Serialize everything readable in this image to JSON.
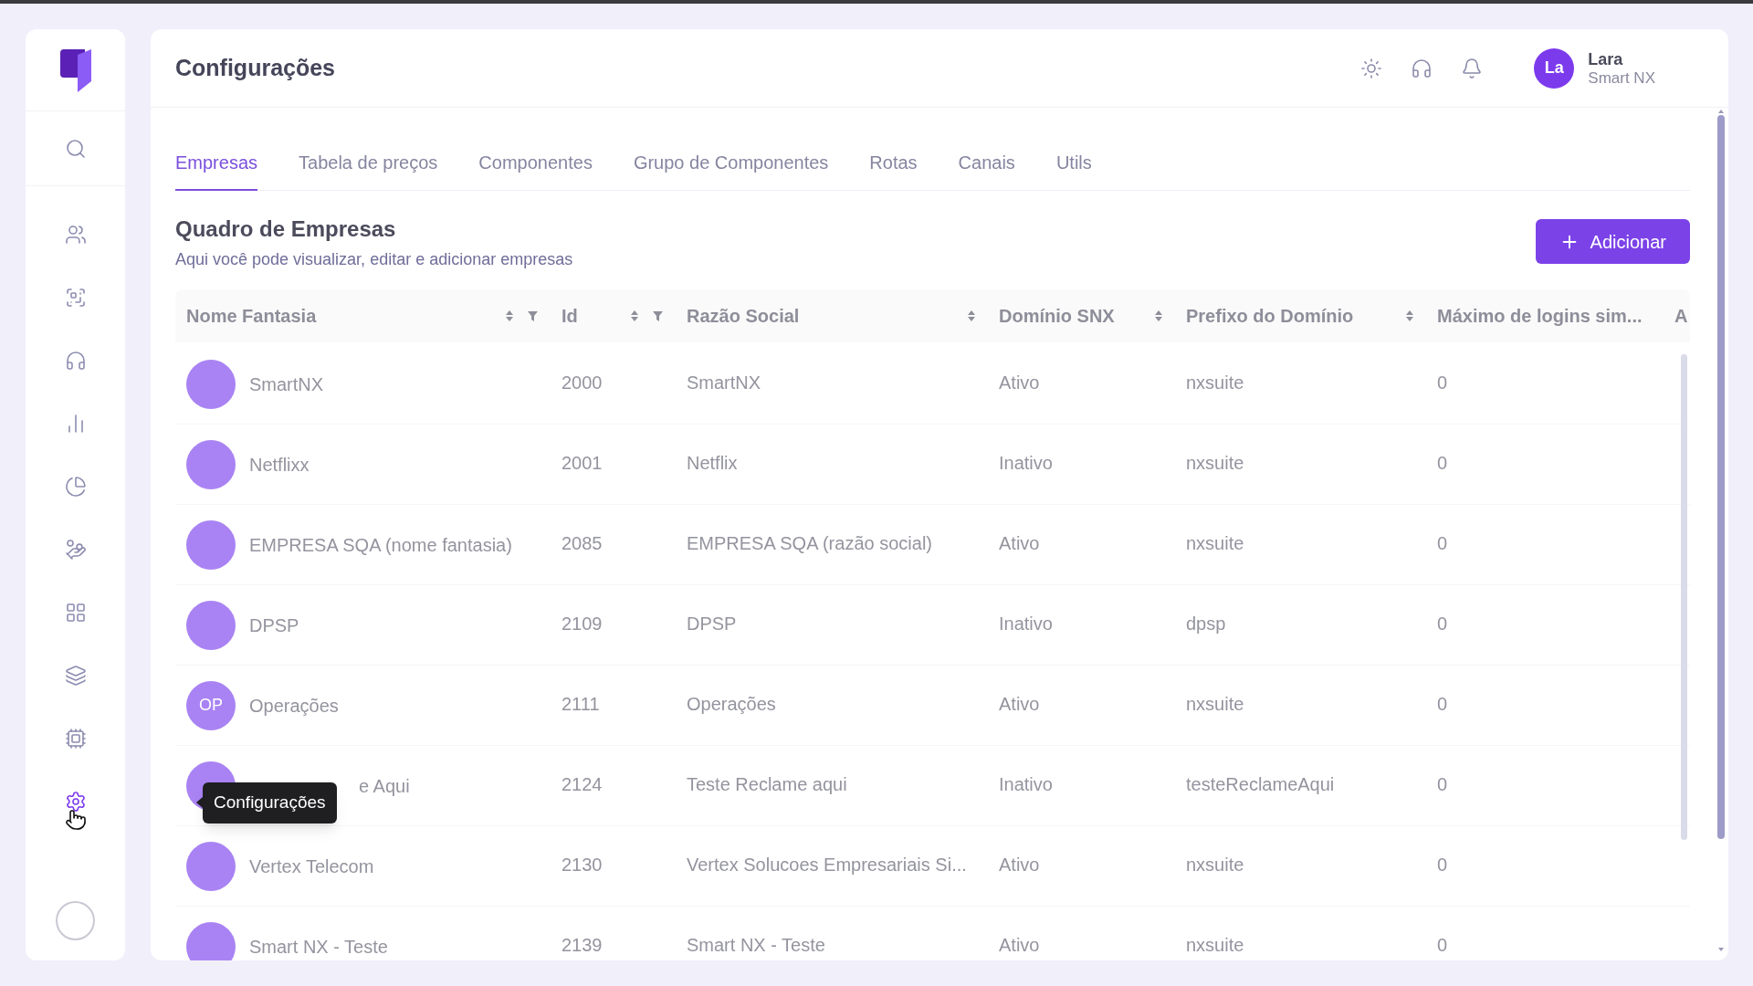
{
  "sidebar": {
    "items": [
      {
        "selected": false
      },
      {
        "selected": false
      },
      {
        "selected": false
      },
      {
        "selected": false
      },
      {
        "selected": false
      },
      {
        "selected": false
      },
      {
        "selected": false
      },
      {
        "selected": false
      },
      {
        "selected": false
      },
      {
        "selected": false
      },
      {
        "selected": true
      }
    ],
    "tooltip": {
      "text": "Configurações"
    }
  },
  "header": {
    "title": "Configurações",
    "user": {
      "initials": "La",
      "name": "Lara",
      "org": "Smart NX"
    }
  },
  "tabs": [
    {
      "label": "Empresas",
      "selected": true
    },
    {
      "label": "Tabela de preços",
      "selected": false
    },
    {
      "label": "Componentes",
      "selected": false
    },
    {
      "label": "Grupo de Componentes",
      "selected": false
    },
    {
      "label": "Rotas",
      "selected": false
    },
    {
      "label": "Canais",
      "selected": false
    },
    {
      "label": "Utils",
      "selected": false
    }
  ],
  "section": {
    "title": "Quadro de Empresas",
    "subtitle": "Aqui você pode visualizar, editar e adicionar empresas",
    "add_button": "Adicionar"
  },
  "table": {
    "loading": true,
    "columns": [
      {
        "label": "Nome Fantasia",
        "sortable": true,
        "filterable": true
      },
      {
        "label": "Id",
        "sortable": true,
        "filterable": true
      },
      {
        "label": "Razão Social",
        "sortable": true,
        "filterable": false
      },
      {
        "label": "Domínio SNX",
        "sortable": true,
        "filterable": false
      },
      {
        "label": "Prefixo do Domínio",
        "sortable": true,
        "filterable": false
      },
      {
        "label": "Máximo de logins sim...",
        "sortable": false,
        "filterable": false
      },
      {
        "label": "A",
        "sortable": false,
        "filterable": false
      }
    ],
    "rows": [
      {
        "name": "SmartNX",
        "name_covered": false,
        "id": "2000",
        "legal_name": "SmartNX",
        "snx_domain": "Ativo",
        "domain_prefix": "nxsuite",
        "max_logins": "0"
      },
      {
        "name": "Netflixx",
        "name_covered": false,
        "id": "2001",
        "legal_name": "Netflix",
        "snx_domain": "Inativo",
        "domain_prefix": "nxsuite",
        "max_logins": "0"
      },
      {
        "name": "EMPRESA SQA (nome fantasia)",
        "name_covered": false,
        "id": "2085",
        "legal_name": "EMPRESA SQA (razão social)",
        "snx_domain": "Ativo",
        "domain_prefix": "nxsuite",
        "max_logins": "0"
      },
      {
        "name": "DPSP",
        "name_covered": false,
        "id": "2109",
        "legal_name": "DPSP",
        "snx_domain": "Inativo",
        "domain_prefix": "dpsp",
        "max_logins": "0"
      },
      {
        "avatar": "OP",
        "name": "Operações",
        "name_covered": false,
        "id": "2111",
        "legal_name": "Operações",
        "snx_domain": "Ativo",
        "domain_prefix": "nxsuite",
        "max_logins": "0"
      },
      {
        "name": "e Aqui",
        "name_covered": true,
        "id": "2124",
        "legal_name": "Teste Reclame aqui",
        "snx_domain": "Inativo",
        "domain_prefix": "testeReclameAqui",
        "max_logins": "0"
      },
      {
        "name": "Vertex Telecom",
        "name_covered": false,
        "id": "2130",
        "legal_name": "Vertex Solucoes Empresariais Si...",
        "snx_domain": "Ativo",
        "domain_prefix": "nxsuite",
        "max_logins": "0"
      },
      {
        "name": "Smart NX - Teste",
        "name_covered": false,
        "id": "2139",
        "legal_name": "Smart NX - Teste",
        "snx_domain": "Ativo",
        "domain_prefix": "nxsuite",
        "max_logins": "0"
      }
    ]
  }
}
